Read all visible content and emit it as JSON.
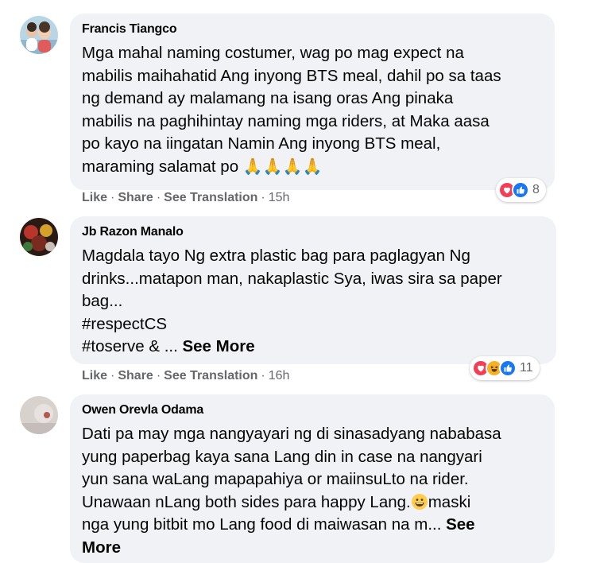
{
  "comments": [
    {
      "author": "Francis Tiangco",
      "lines": [
        "Mga mahal naming costumer, wag po mag expect na",
        "mabilis maihahatid Ang inyong BTS meal, dahil po sa taas",
        "ng demand ay malamang na isang oras Ang pinaka",
        "mabilis na paghihintay naming mga riders, at Maka aasa",
        "po kayo na iingatan Namin Ang inyong BTS meal,",
        "maraming salamat po"
      ],
      "emoji": "🙏🙏🙏🙏",
      "like": "Like",
      "share": "Share",
      "translate": "See Translation",
      "time": "15h",
      "reaction_icons": [
        "heart-icon",
        "like-icon"
      ],
      "reaction_count": "8"
    },
    {
      "author": "Jb Razon Manalo",
      "lines": [
        "Magdala tayo Ng extra plastic bag para paglagyan Ng",
        "drinks...matapon man, nakaplastic Sya, iwas sira sa paper",
        "bag...",
        "#respectCS",
        "#toserve & ..."
      ],
      "see_more": "See More",
      "like": "Like",
      "share": "Share",
      "translate": "See Translation",
      "time": "16h",
      "reaction_icons": [
        "heart-icon",
        "haha-icon",
        "like-icon"
      ],
      "reaction_count": "11"
    },
    {
      "author": "Owen Orevla Odama",
      "lines": [
        "Dati pa may mga nangyayari ng di sinasadyang nababasa",
        "yung paperbag kaya sana Lang din in case na nangyari",
        "yun sana waLang mapapahiya or maiinsuLto na rider.",
        "Unawaan nLang both sides para happy Lang.",
        "nga yung bitbit mo Lang food di maiwasan na m... ",
        "More"
      ],
      "line4_tail": "maski",
      "see_more_part": "See"
    }
  ],
  "colors": {
    "bubble": "#f0f2f5",
    "meta": "#65676b",
    "text": "#050505",
    "heart": "#f33e58",
    "like": "#1877f2",
    "haha": "#f7b125"
  }
}
